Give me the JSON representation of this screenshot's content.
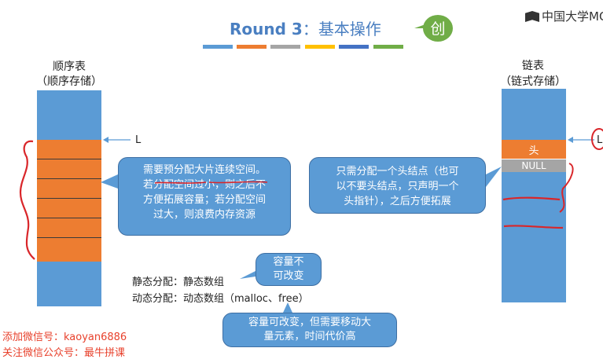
{
  "slide": {
    "title_en": "Round 3",
    "title_sep": "：",
    "title_cn": "基本操作",
    "badge": "创",
    "logo": "中国大学MO",
    "colorbar": [
      "#5b9bd5",
      "#ed7d31",
      "#a5a5a5",
      "#ffc000",
      "#4472c4",
      "#70ad47"
    ]
  },
  "seq": {
    "title": "顺序表",
    "subtitle": "（顺序存储）",
    "pointer": "L",
    "cells": 6
  },
  "link": {
    "title": "链表",
    "subtitle": "（链式存储）",
    "pointer": "L",
    "head": "头",
    "null": "NULL"
  },
  "callouts": {
    "seq_note": [
      "需要预分配大片连续空间。",
      "若分配空间过小，则之后不",
      "方便拓展容量；若分配空间",
      "过大，则浪费内存资源"
    ],
    "link_note": [
      "只需分配一个头结点（也可",
      "以不要头结点，只声明一个",
      "头指针），之后方便拓展"
    ],
    "static_note": [
      "容量不",
      "可改变"
    ],
    "dynamic_note": [
      "容量可改变，但需要移动大",
      "量元素，时间代价高"
    ]
  },
  "alloc": {
    "static": "静态分配：静态数组",
    "dynamic": "动态分配：动态数组（malloc、free）"
  },
  "watermark": {
    "line1": "添加微信号：kaoyan6886",
    "line2": "关注微信公众号：最牛拼课"
  }
}
